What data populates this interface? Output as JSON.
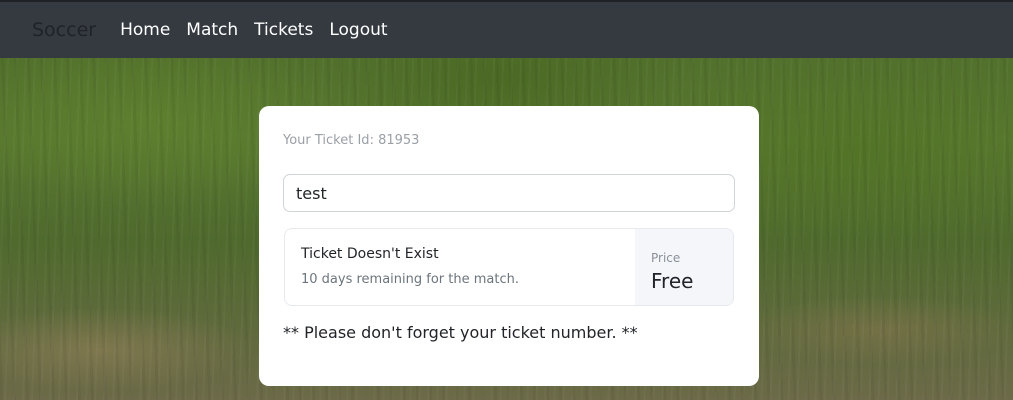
{
  "navbar": {
    "brand": "Soccer",
    "links": [
      "Home",
      "Match",
      "Tickets",
      "Logout"
    ]
  },
  "card": {
    "ticket_id_label": "Your Ticket Id: 81953",
    "input_value": "test",
    "status_title": "Ticket Doesn't Exist",
    "status_subtitle": "10 days remaining for the match.",
    "price_label": "Price",
    "price_value": "Free",
    "reminder": "** Please don't forget your ticket number. **"
  },
  "colors": {
    "navbar_bg": "#343a40",
    "brand_text": "#1f2327",
    "card_bg": "#ffffff",
    "price_panel_bg": "#f4f6fa"
  }
}
